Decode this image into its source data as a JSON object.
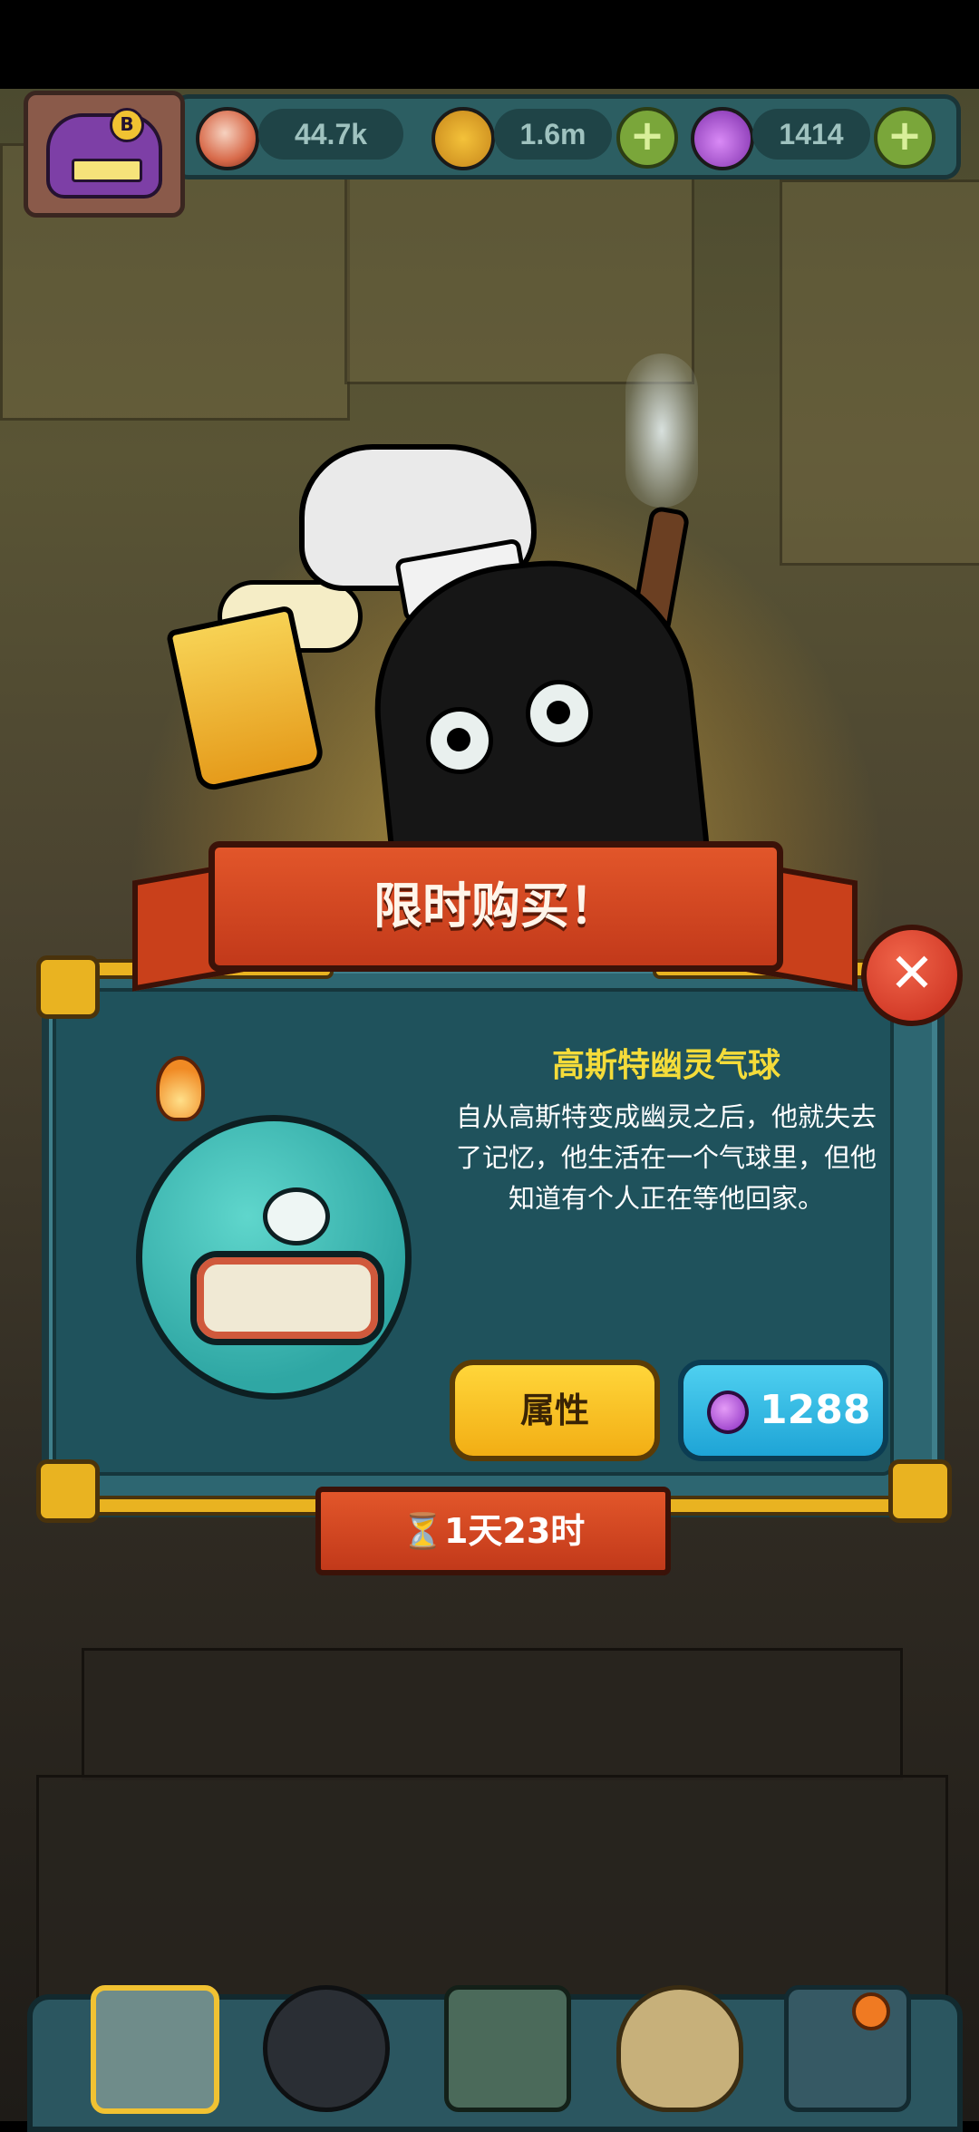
{
  "status_bar": {},
  "resources": {
    "eyeballs": "44.7k",
    "coins": "1.6m",
    "potions": "1414",
    "plus": "+"
  },
  "avatar": {
    "letter": "B"
  },
  "offer": {
    "banner_title": "限时购买！",
    "close_label": "✕",
    "item_name": "高斯特幽灵气球",
    "item_description": "自从高斯特变成幽灵之后，他就失去了记忆，他生活在一个气球里，但他知道有个人正在等他回家。",
    "attributes_button": "属性",
    "price": "1288",
    "timer": "⏳1天23时"
  },
  "colors": {
    "banner_red": "#d24a22",
    "panel_teal": "#2d6671",
    "title_yellow": "#f4dc3a",
    "attr_button_yellow": "#ffd63a",
    "price_button_blue": "#2fb9e4"
  },
  "bottom_nav": {
    "icons": [
      "shop-icon",
      "monster-icon",
      "book-icon",
      "coin-bag-icon",
      "grid-icon"
    ]
  }
}
